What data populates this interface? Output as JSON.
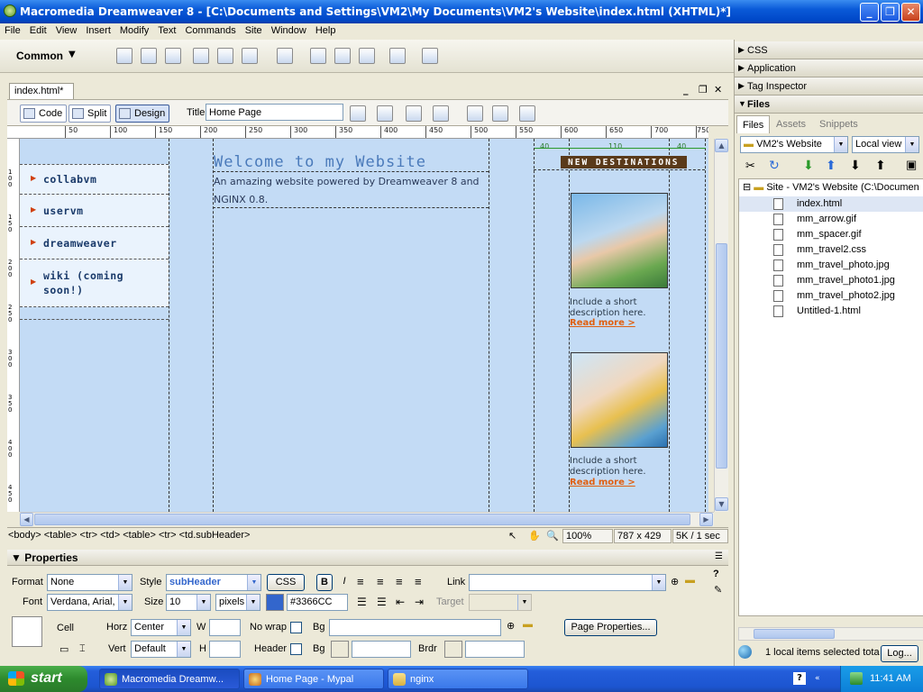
{
  "window": {
    "title": "Macromedia Dreamweaver 8 - [C:\\Documents and Settings\\VM2\\My Documents\\VM2's Website\\index.html (XHTML)*]"
  },
  "menu": [
    "File",
    "Edit",
    "View",
    "Insert",
    "Modify",
    "Text",
    "Commands",
    "Site",
    "Window",
    "Help"
  ],
  "insert_bar": {
    "category": "Common"
  },
  "document": {
    "tab": "index.html*",
    "views": {
      "code": "Code",
      "split": "Split",
      "design": "Design"
    },
    "title_label": "Title:",
    "title_value": "Home Page"
  },
  "ruler": {
    "ticks": [
      "0",
      "50",
      "100",
      "150",
      "200",
      "250",
      "300",
      "350",
      "400",
      "450",
      "500",
      "550",
      "600",
      "650",
      "700",
      "750"
    ],
    "vticks": [
      "50",
      "100",
      "150",
      "200",
      "250",
      "300",
      "350",
      "400",
      "450",
      "500",
      "550"
    ]
  },
  "page": {
    "nav": [
      "collabvm",
      "uservm",
      "dreamweaver",
      "wiki (coming soon!)"
    ],
    "welcome": "Welcome to my Website",
    "intro": "An amazing website powered by Dreamweaver 8 and NGINX 0.8.",
    "measure": {
      "left": "40",
      "mid": "110",
      "right": "40"
    },
    "destinations_header": "NEW DESTINATIONS",
    "items": [
      {
        "desc": "Include a short description here.",
        "link": "Read more >"
      },
      {
        "desc": "Include a short description here.",
        "link": "Read more >"
      }
    ]
  },
  "status": {
    "tags": "<body> <table> <tr> <td> <table> <tr> <td.subHeader>",
    "zoom": "100%",
    "size": "787 x 429",
    "weight": "5K / 1 sec"
  },
  "properties": {
    "title": "Properties",
    "format_label": "Format",
    "format": "None",
    "style_label": "Style",
    "style": "subHeader",
    "css_btn": "CSS",
    "link_label": "Link",
    "link": "",
    "font_label": "Font",
    "font": "Verdana, Arial,",
    "size_label": "Size",
    "size": "10",
    "unit": "pixels",
    "color_value": "#3366CC",
    "target_label": "Target",
    "cell_label": "Cell",
    "horz_label": "Horz",
    "horz": "Center",
    "w_label": "W",
    "w": "",
    "nowrap_label": "No wrap",
    "bg_label": "Bg",
    "bg": "",
    "page_props_btn": "Page Properties...",
    "vert_label": "Vert",
    "vert": "Default",
    "h_label": "H",
    "h": "",
    "header_label": "Header",
    "bg2_label": "Bg",
    "brdr_label": "Brdr",
    "bold": "B",
    "italic": "I"
  },
  "panels": {
    "css": "CSS",
    "application": "Application",
    "tag_inspector": "Tag Inspector",
    "files": "Files",
    "tabs": [
      "Files",
      "Assets",
      "Snippets"
    ],
    "site": "VM2's Website",
    "view": "Local view",
    "root": "Site - VM2's Website (C:\\Documen",
    "files_list": [
      "index.html",
      "mm_arrow.gif",
      "mm_spacer.gif",
      "mm_travel2.css",
      "mm_travel_photo.jpg",
      "mm_travel_photo1.jpg",
      "mm_travel_photo2.jpg",
      "Untitled-1.html"
    ],
    "status": "1 local items selected tota",
    "log_btn": "Log..."
  },
  "taskbar": {
    "start": "start",
    "tasks": [
      "Macromedia Dreamw...",
      "Home Page - Mypal",
      "nginx"
    ],
    "clock": "11:41 AM"
  },
  "colors": {
    "titlebar": "#0a5ad8",
    "canvas": "#c3dbf5",
    "accent": "#3366CC",
    "link": "#e06010",
    "dest_header": "#5a3a1a"
  }
}
